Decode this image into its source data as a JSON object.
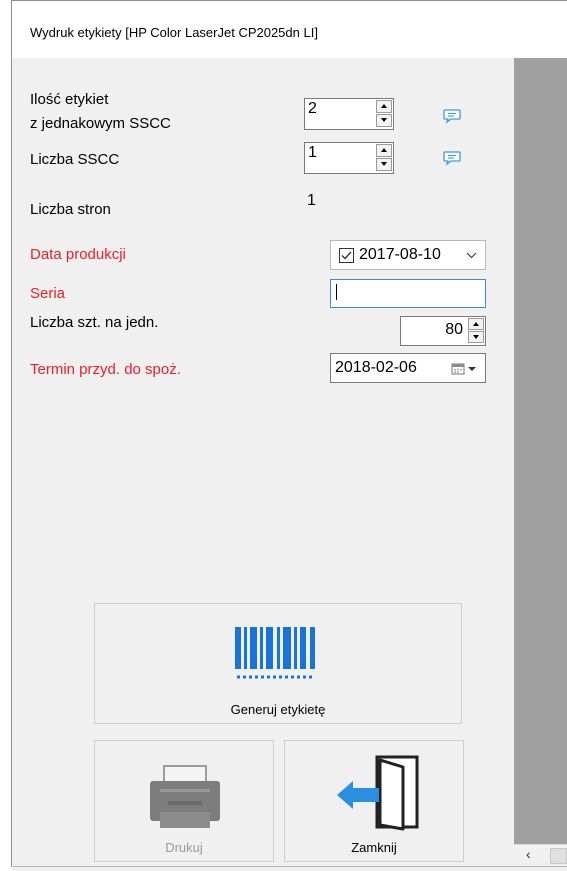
{
  "window": {
    "title": "Wydruk etykiety [HP Color LaserJet CP2025dn LI]"
  },
  "form": {
    "qty_labels_line1": "Ilość etykiet",
    "qty_labels_line2": "z jednakowym SSCC",
    "qty_labels_value": "2",
    "sscc_count_label": "Liczba SSCC",
    "sscc_count_value": "1",
    "pages_label": "Liczba stron",
    "pages_value": "1",
    "production_date_label": "Data produkcji",
    "production_date_value": "2017-08-10",
    "production_date_checked": true,
    "series_label": "Seria",
    "series_value": "",
    "units_label": "Liczba szt. na jedn.",
    "units_value": "80",
    "expiry_label": "Termin przyd. do spoż.",
    "expiry_value": "2018-02-06"
  },
  "buttons": {
    "generate": "Generuj etykietę",
    "print": "Drukuj",
    "print_enabled": false,
    "close": "Zamknij"
  },
  "colors": {
    "required_label": "#e8202a",
    "barcode_blue": "#1a73d9",
    "exit_arrow_blue": "#2b8fe0"
  },
  "icons": {
    "comment": "speech-bubble",
    "barcode": "barcode",
    "printer": "printer",
    "exit": "door-exit",
    "calendar": "calendar-dropdown"
  }
}
